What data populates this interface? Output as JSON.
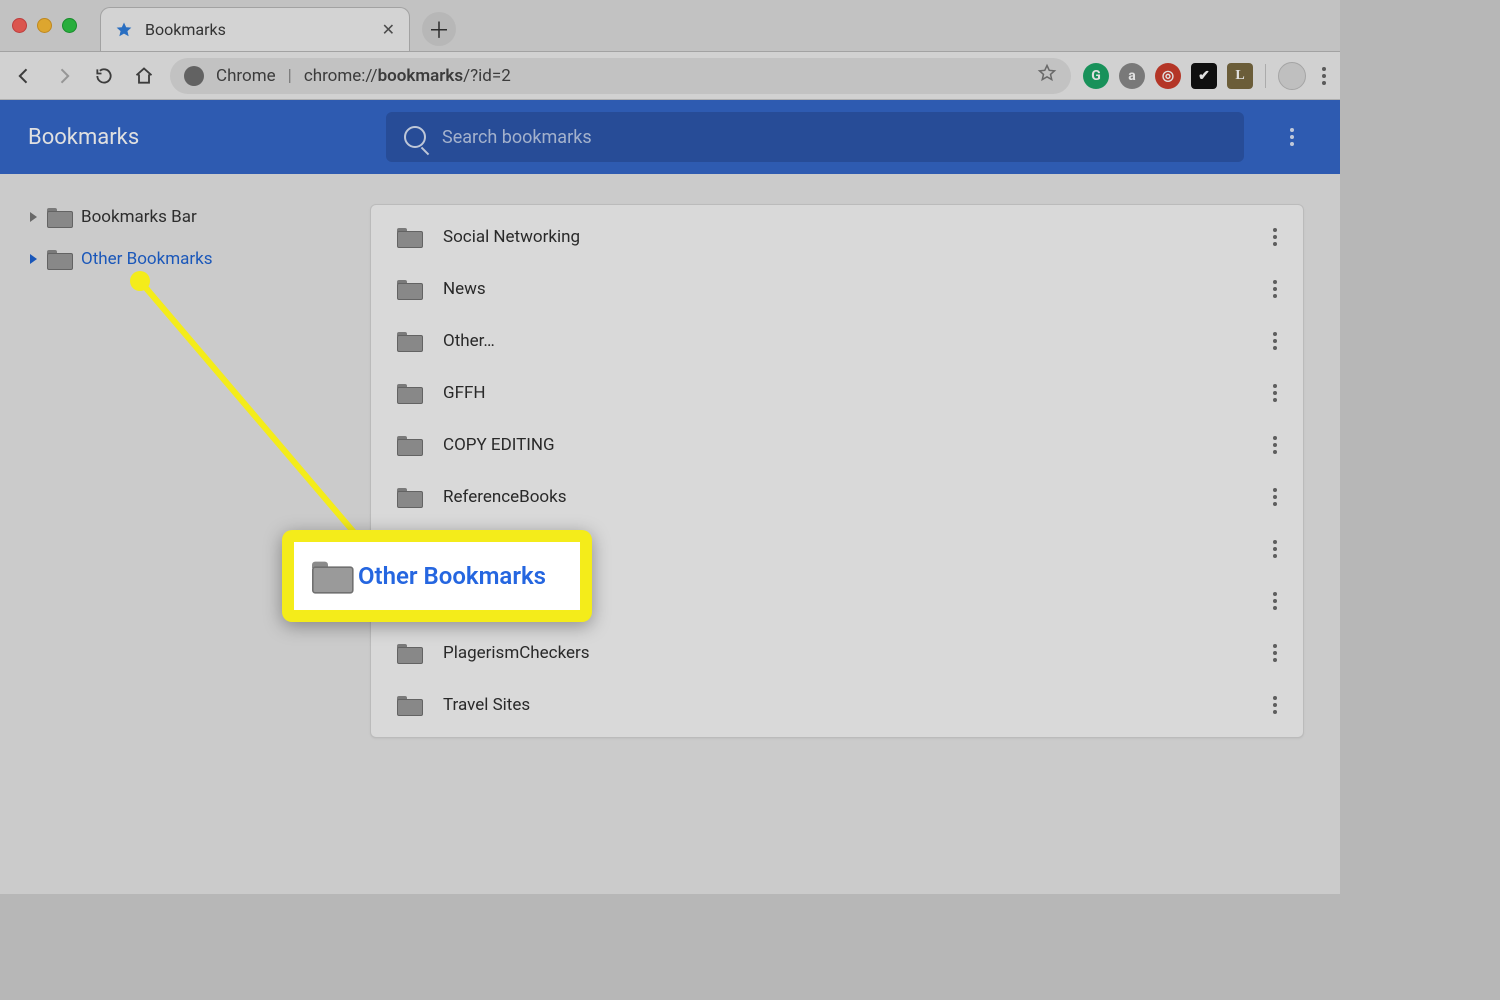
{
  "window": {
    "tab_title": "Bookmarks",
    "tab_favicon": "star-icon"
  },
  "omnibox": {
    "chip_label": "Chrome",
    "url_plain_prefix": "chrome://",
    "url_bold": "bookmarks",
    "url_plain_suffix": "/?id=2"
  },
  "extensions": [
    {
      "name": "grammarly-icon",
      "glyph": "G",
      "class": "g"
    },
    {
      "name": "amazon-assistant-icon",
      "glyph": "a",
      "class": "a"
    },
    {
      "name": "opera-red-icon",
      "glyph": "◎",
      "class": "o"
    },
    {
      "name": "todo-check-icon",
      "glyph": "✔",
      "class": "sq"
    },
    {
      "name": "letter-l-icon",
      "glyph": "L",
      "class": "l"
    }
  ],
  "app": {
    "title": "Bookmarks",
    "search_placeholder": "Search bookmarks"
  },
  "sidebar": {
    "items": [
      {
        "label": "Bookmarks Bar",
        "selected": false
      },
      {
        "label": "Other Bookmarks",
        "selected": true
      }
    ]
  },
  "folders": [
    {
      "label": "Social Networking"
    },
    {
      "label": "News"
    },
    {
      "label": "Other…"
    },
    {
      "label": "GFFH"
    },
    {
      "label": "COPY EDITING"
    },
    {
      "label": "ReferenceBooks"
    },
    {
      "label": ""
    },
    {
      "label": ""
    },
    {
      "label": "PlagerismCheckers"
    },
    {
      "label": "Travel Sites"
    }
  ],
  "callout": {
    "label": "Other Bookmarks"
  }
}
